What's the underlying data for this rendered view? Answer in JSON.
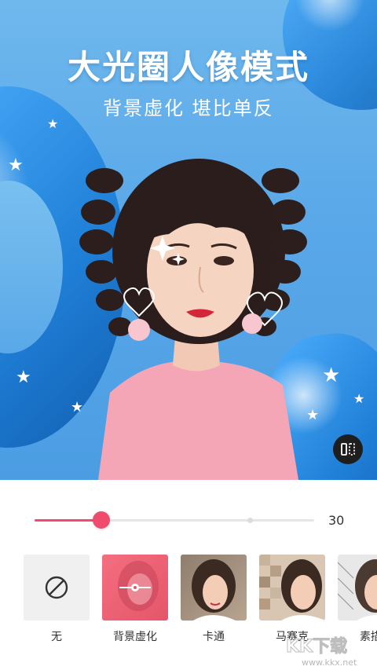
{
  "header": {
    "title": "大光圈人像模式",
    "subtitle": "背景虚化  堪比单反"
  },
  "compare_button": {
    "icon": "compare-icon"
  },
  "slider": {
    "value_text": "30",
    "fill_fraction": 0.24,
    "marker_fraction": 0.77,
    "color": "#f04b6c"
  },
  "effects": [
    {
      "label": "无",
      "icon": "none-icon",
      "selected": false
    },
    {
      "label": "背景虚化",
      "icon": "blur-slider-icon",
      "selected": true
    },
    {
      "label": "卡通",
      "selected": false
    },
    {
      "label": "马赛克",
      "selected": false
    },
    {
      "label": "素描",
      "selected": false
    }
  ],
  "watermark": {
    "text": "KK下载",
    "url": "www.kkx.net"
  }
}
